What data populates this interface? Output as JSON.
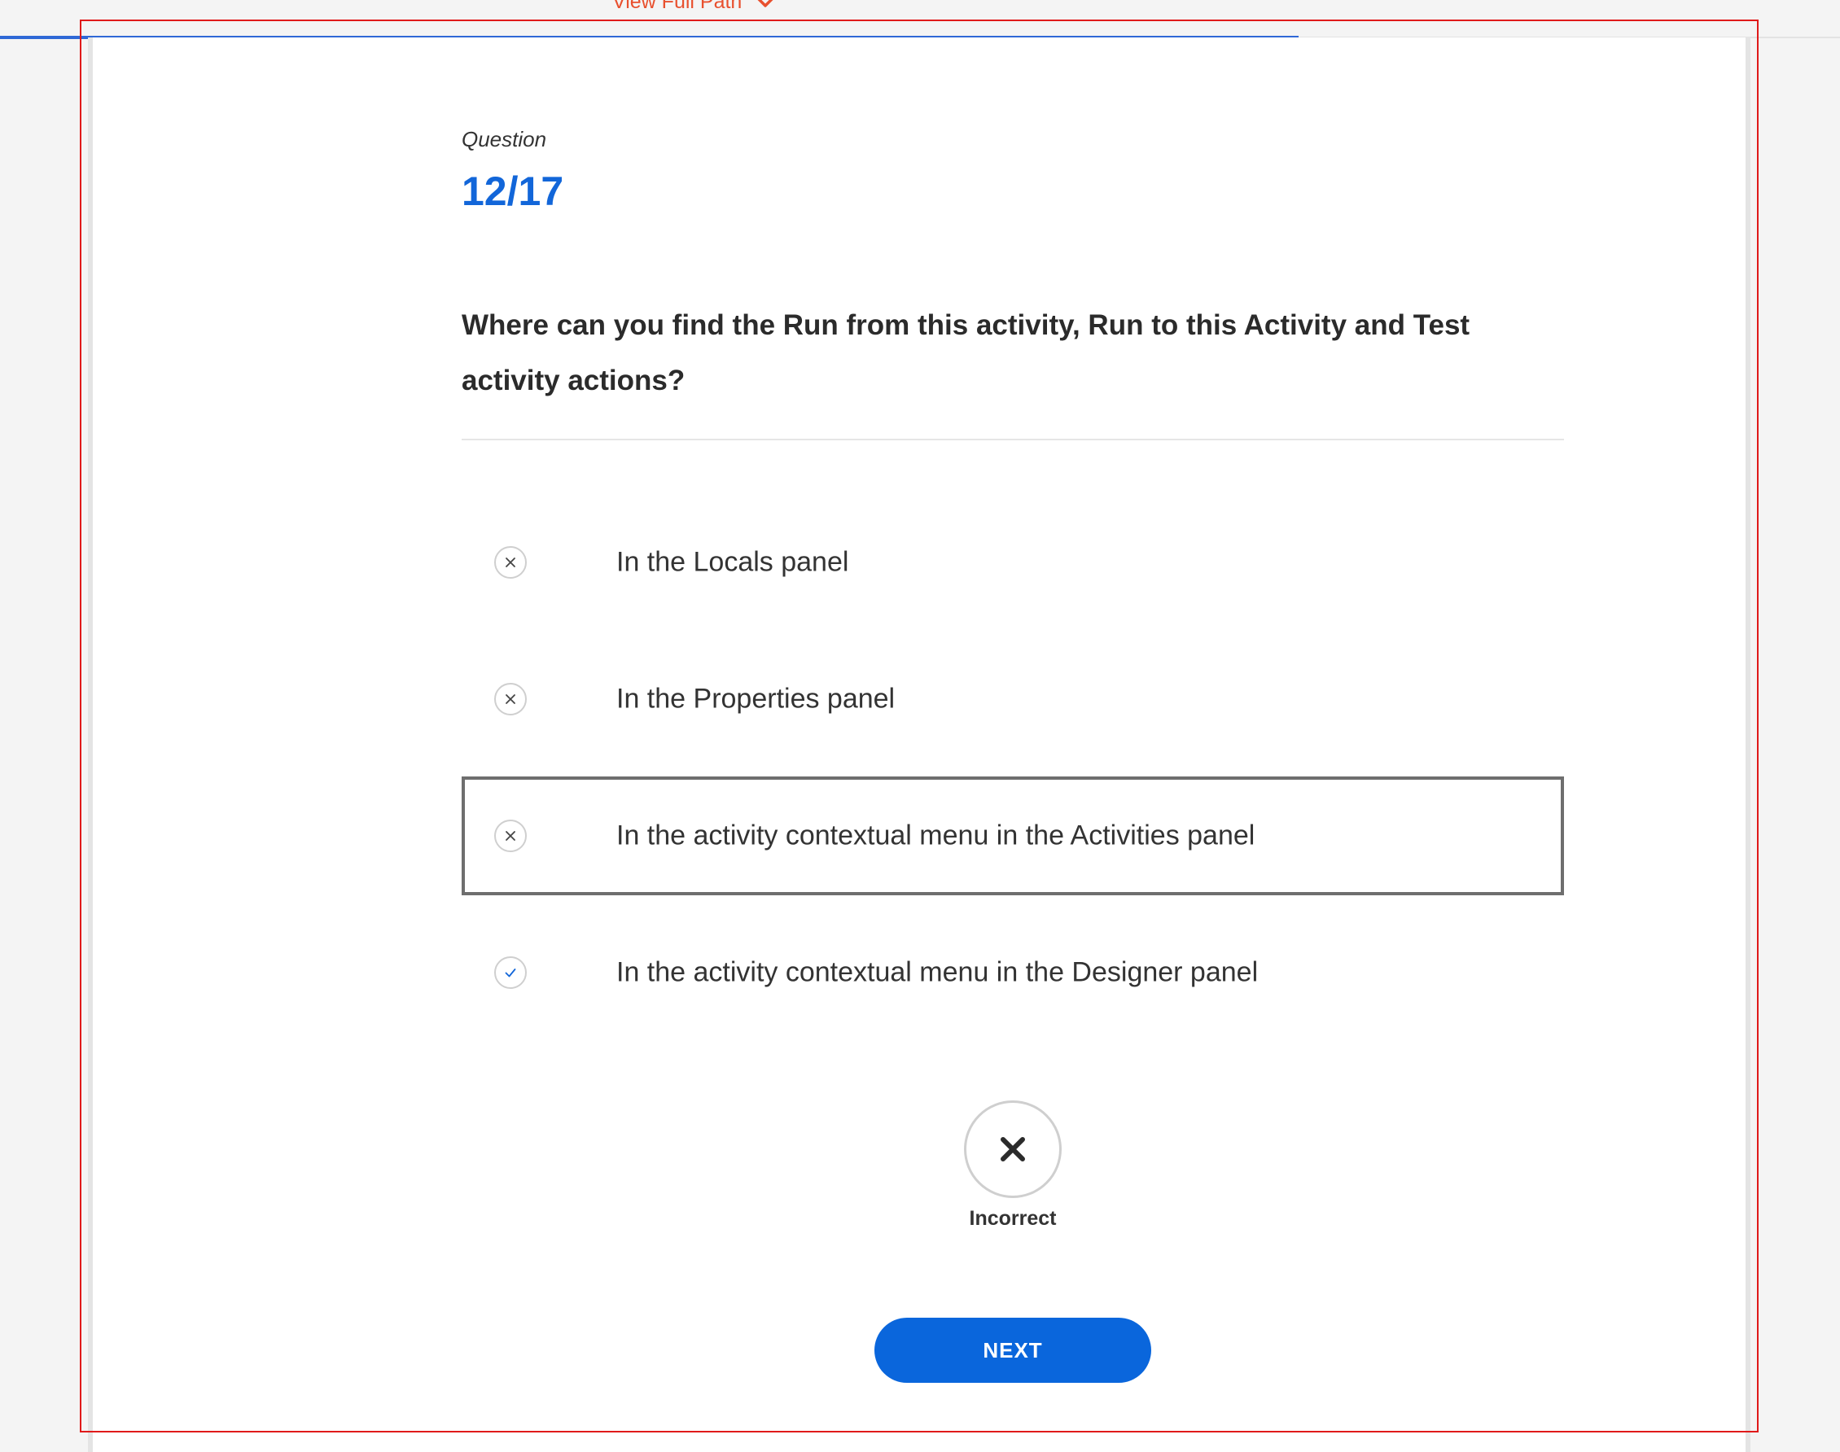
{
  "header": {
    "view_full_path_label": "View Full Path",
    "link_color": "#e8502e"
  },
  "progress": {
    "fraction": 0.7058,
    "color": "#2f68d6"
  },
  "question": {
    "label": "Question",
    "counter": "12/17",
    "text": "Where can you find the Run from this activity, Run to this Activity and Test activity actions?"
  },
  "options": [
    {
      "label": "In the Locals panel",
      "status": "incorrect",
      "icon": "close-icon",
      "selected": false
    },
    {
      "label": "In the Properties panel",
      "status": "incorrect",
      "icon": "close-icon",
      "selected": false
    },
    {
      "label": "In the activity contextual menu in the Activities panel",
      "status": "incorrect",
      "icon": "close-icon",
      "selected": true
    },
    {
      "label": "In the activity contextual menu in the Designer panel",
      "status": "correct",
      "icon": "check-icon",
      "selected": false
    }
  ],
  "result": {
    "icon": "close-icon",
    "label": "Incorrect"
  },
  "actions": {
    "next_label": "NEXT",
    "button_color": "#0a66dc"
  },
  "colors": {
    "accent": "#1266d9",
    "correct_check": "#1266d9",
    "selection_outline": "#e01a1a"
  }
}
